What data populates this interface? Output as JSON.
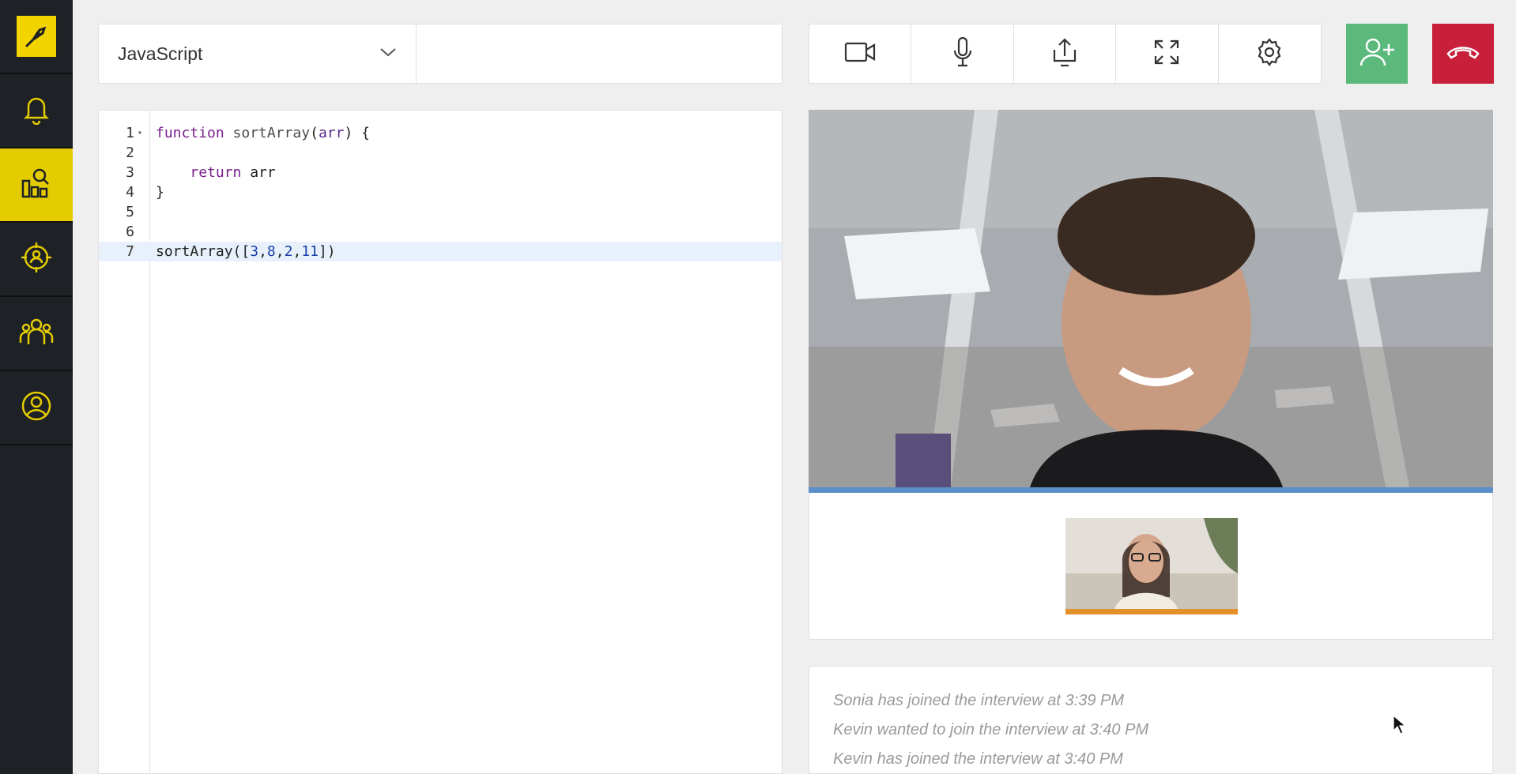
{
  "sidebar": {
    "items": [
      {
        "name": "logo",
        "icon": "pen-logo-icon"
      },
      {
        "name": "notifications",
        "icon": "bell-icon"
      },
      {
        "name": "reports",
        "icon": "chart-search-icon",
        "active": true
      },
      {
        "name": "sourcing",
        "icon": "target-person-icon"
      },
      {
        "name": "team",
        "icon": "group-icon"
      },
      {
        "name": "profile",
        "icon": "user-circle-icon"
      }
    ]
  },
  "editor": {
    "language": "JavaScript",
    "lines": [
      {
        "num": "1",
        "tokens": [
          [
            "kw",
            "function"
          ],
          [
            "txt",
            " "
          ],
          [
            "fn",
            "sortArray"
          ],
          [
            "txt",
            "("
          ],
          [
            "par",
            "arr"
          ],
          [
            "txt",
            ") {"
          ]
        ],
        "fold": true
      },
      {
        "num": "2",
        "tokens": []
      },
      {
        "num": "3",
        "tokens": [
          [
            "txt",
            "    "
          ],
          [
            "kw",
            "return"
          ],
          [
            "txt",
            " arr"
          ]
        ]
      },
      {
        "num": "4",
        "tokens": [
          [
            "txt",
            "}"
          ]
        ]
      },
      {
        "num": "5",
        "tokens": []
      },
      {
        "num": "6",
        "tokens": []
      },
      {
        "num": "7",
        "tokens": [
          [
            "txt",
            "sortArray(["
          ],
          [
            "num",
            "3"
          ],
          [
            "txt",
            ","
          ],
          [
            "num",
            "8"
          ],
          [
            "txt",
            ","
          ],
          [
            "num",
            "2"
          ],
          [
            "txt",
            ","
          ],
          [
            "num",
            "11"
          ],
          [
            "txt",
            "])"
          ]
        ],
        "current": true
      }
    ]
  },
  "toolbar": {
    "buttons": [
      "camera-icon",
      "microphone-icon",
      "share-screen-icon",
      "fullscreen-icon",
      "gear-icon"
    ],
    "add_participant_icon": "add-user-icon",
    "hang_up_icon": "phone-hangup-icon"
  },
  "colors": {
    "accent": "#e4cc00",
    "add": "#5cb97c",
    "hangup": "#c8203a",
    "active_speaker": "#5b8fc9",
    "self_view": "#e4902a"
  },
  "log": {
    "entries": [
      "Sonia has joined the interview at 3:39 PM",
      "Kevin wanted to join the interview at 3:40 PM",
      "Kevin has joined the interview at 3:40 PM"
    ]
  }
}
